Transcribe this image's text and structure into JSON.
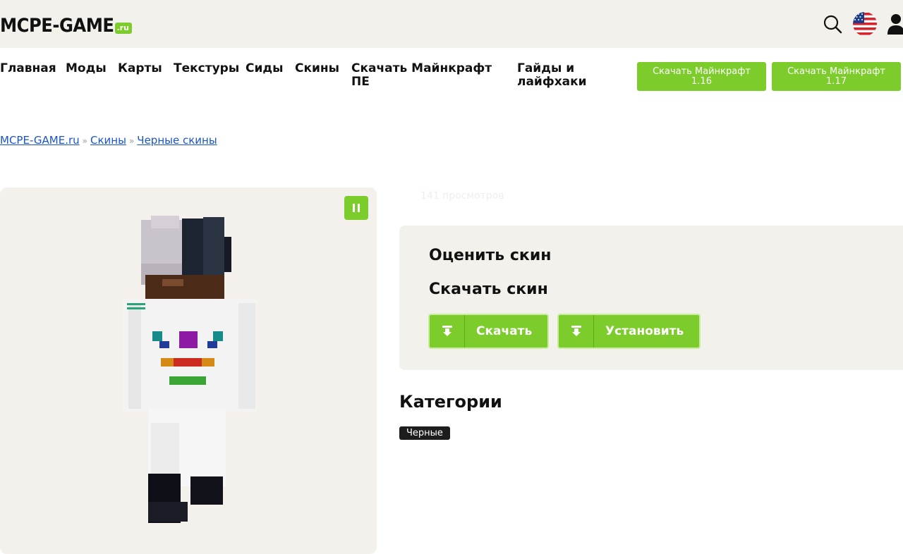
{
  "header": {
    "logo_main": "MCPE-GAME",
    "logo_tld": ".ru",
    "icons": [
      "search-icon",
      "us-flag-icon",
      "user-icon"
    ]
  },
  "nav": {
    "items": [
      "Главная",
      "Моды",
      "Карты",
      "Текстуры",
      "Сиды",
      "Скины",
      "Скачать Майнкрафт ПЕ",
      "Гайды и лайфхаки"
    ],
    "buttons": [
      {
        "line1": "Скачать Майнкрафт",
        "line2": "1.16"
      },
      {
        "line1": "Скачать Майнкрафт",
        "line2": "1.17"
      }
    ]
  },
  "breadcrumbs": {
    "items": [
      "MCPE-GAME.ru",
      "Скины",
      "Черные скины"
    ],
    "separator": "»"
  },
  "preview": {
    "pause_icon": "pause-icon"
  },
  "stats": {
    "views": "141 просмотров"
  },
  "actions": {
    "rate_title": "Оценить скин",
    "download_title": "Скачать скин",
    "download_label": "Скачать",
    "install_label": "Установить"
  },
  "categories": {
    "title": "Категории",
    "tags": [
      "Черные"
    ]
  },
  "colors": {
    "accent": "#7ccd2b",
    "panel": "#f3f1ec",
    "link": "#1a55c7"
  }
}
